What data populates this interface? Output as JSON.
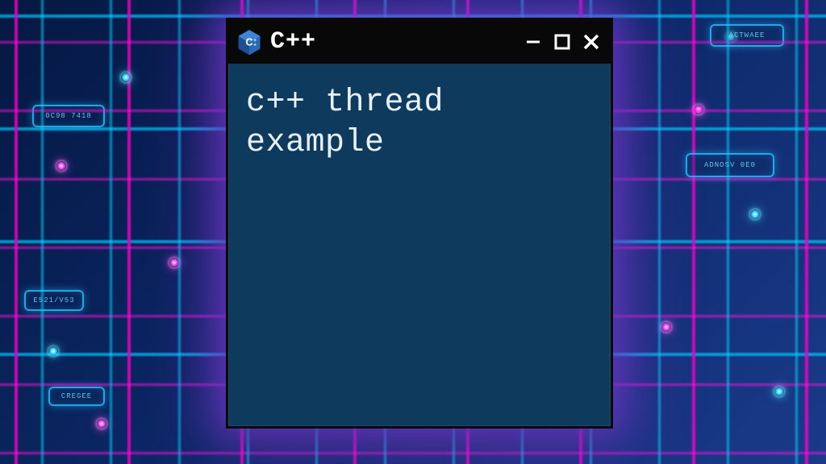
{
  "window": {
    "title": "C++",
    "icon_name": "cpp-logo-icon"
  },
  "content": {
    "text": "c++ thread\nexample"
  },
  "colors": {
    "titlebar_bg": "#080808",
    "window_bg": "#0e3a5e",
    "accent_cyan": "#22d9ff",
    "accent_magenta": "#ff3df0",
    "text": "#e8f0f8"
  }
}
